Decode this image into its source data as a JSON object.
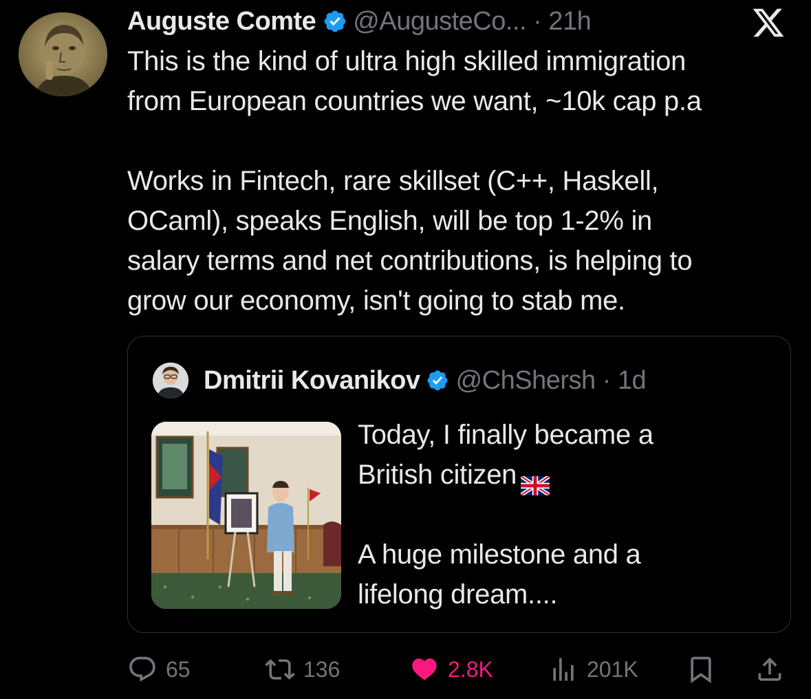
{
  "tweet": {
    "author_name": "Auguste Comte",
    "handle_time": "@AugusteCo... · 21h",
    "text_lines": [
      "This is the kind of ultra high skilled immigration",
      "from European countries we want, ~10k cap p.a",
      "Works in Fintech, rare skillset (C++, Haskell,",
      "OCaml), speaks English, will be top 1-2% in",
      "salary terms and net contributions, is helping to",
      "grow our economy, isn't going to stab me."
    ]
  },
  "quote": {
    "author_name": "Dmitrii Kovanikov",
    "handle_time": "@ChShersh · 1d",
    "text_lines": [
      "Today, I finally became a",
      "British citizen",
      "A huge milestone and a",
      "lifelong dream...."
    ]
  },
  "actions": {
    "replies": "65",
    "reposts": "136",
    "likes": "2.8K",
    "views": "201K"
  },
  "icons": {
    "verified": "verified-badge-icon",
    "platform": "x-logo-icon",
    "flag": "uk-flag-emoji",
    "reply": "reply-icon",
    "repost": "repost-icon",
    "like": "heart-icon",
    "views": "views-icon",
    "bookmark": "bookmark-icon",
    "share": "share-icon"
  },
  "colors": {
    "background": "#000000",
    "text": "#e7e9ea",
    "muted": "#71767b",
    "verified": "#1d9bf0",
    "like": "#f91880",
    "border": "#2f3336"
  }
}
